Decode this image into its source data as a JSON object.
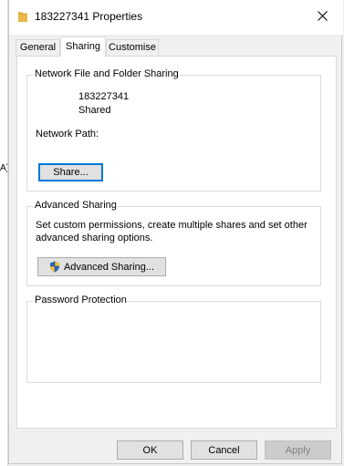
{
  "background_window": {
    "edge_text": "A)"
  },
  "window": {
    "title": "183227341 Properties",
    "icons": {
      "title": "folder-icon",
      "close": "close-icon"
    }
  },
  "tabs": [
    {
      "label": "General",
      "active": false
    },
    {
      "label": "Sharing",
      "active": true
    },
    {
      "label": "Customise",
      "active": false
    }
  ],
  "network_sharing": {
    "group_label": "Network File and Folder Sharing",
    "item_name": "183227341",
    "status": "Shared",
    "path_label": "Network Path:",
    "share_button": "Share..."
  },
  "advanced_sharing": {
    "group_label": "Advanced Sharing",
    "description_line1": "Set custom permissions, create multiple shares and set other",
    "description_line2": "advanced sharing options.",
    "button": "Advanced Sharing...",
    "button_icon": "uac-shield-icon"
  },
  "password_protection": {
    "group_label": "Password Protection"
  },
  "footer": {
    "ok": "OK",
    "cancel": "Cancel",
    "apply": "Apply"
  },
  "colors": {
    "accent": "#0078d7",
    "folder": "#e8b84a",
    "shield_blue": "#2b66c4"
  }
}
